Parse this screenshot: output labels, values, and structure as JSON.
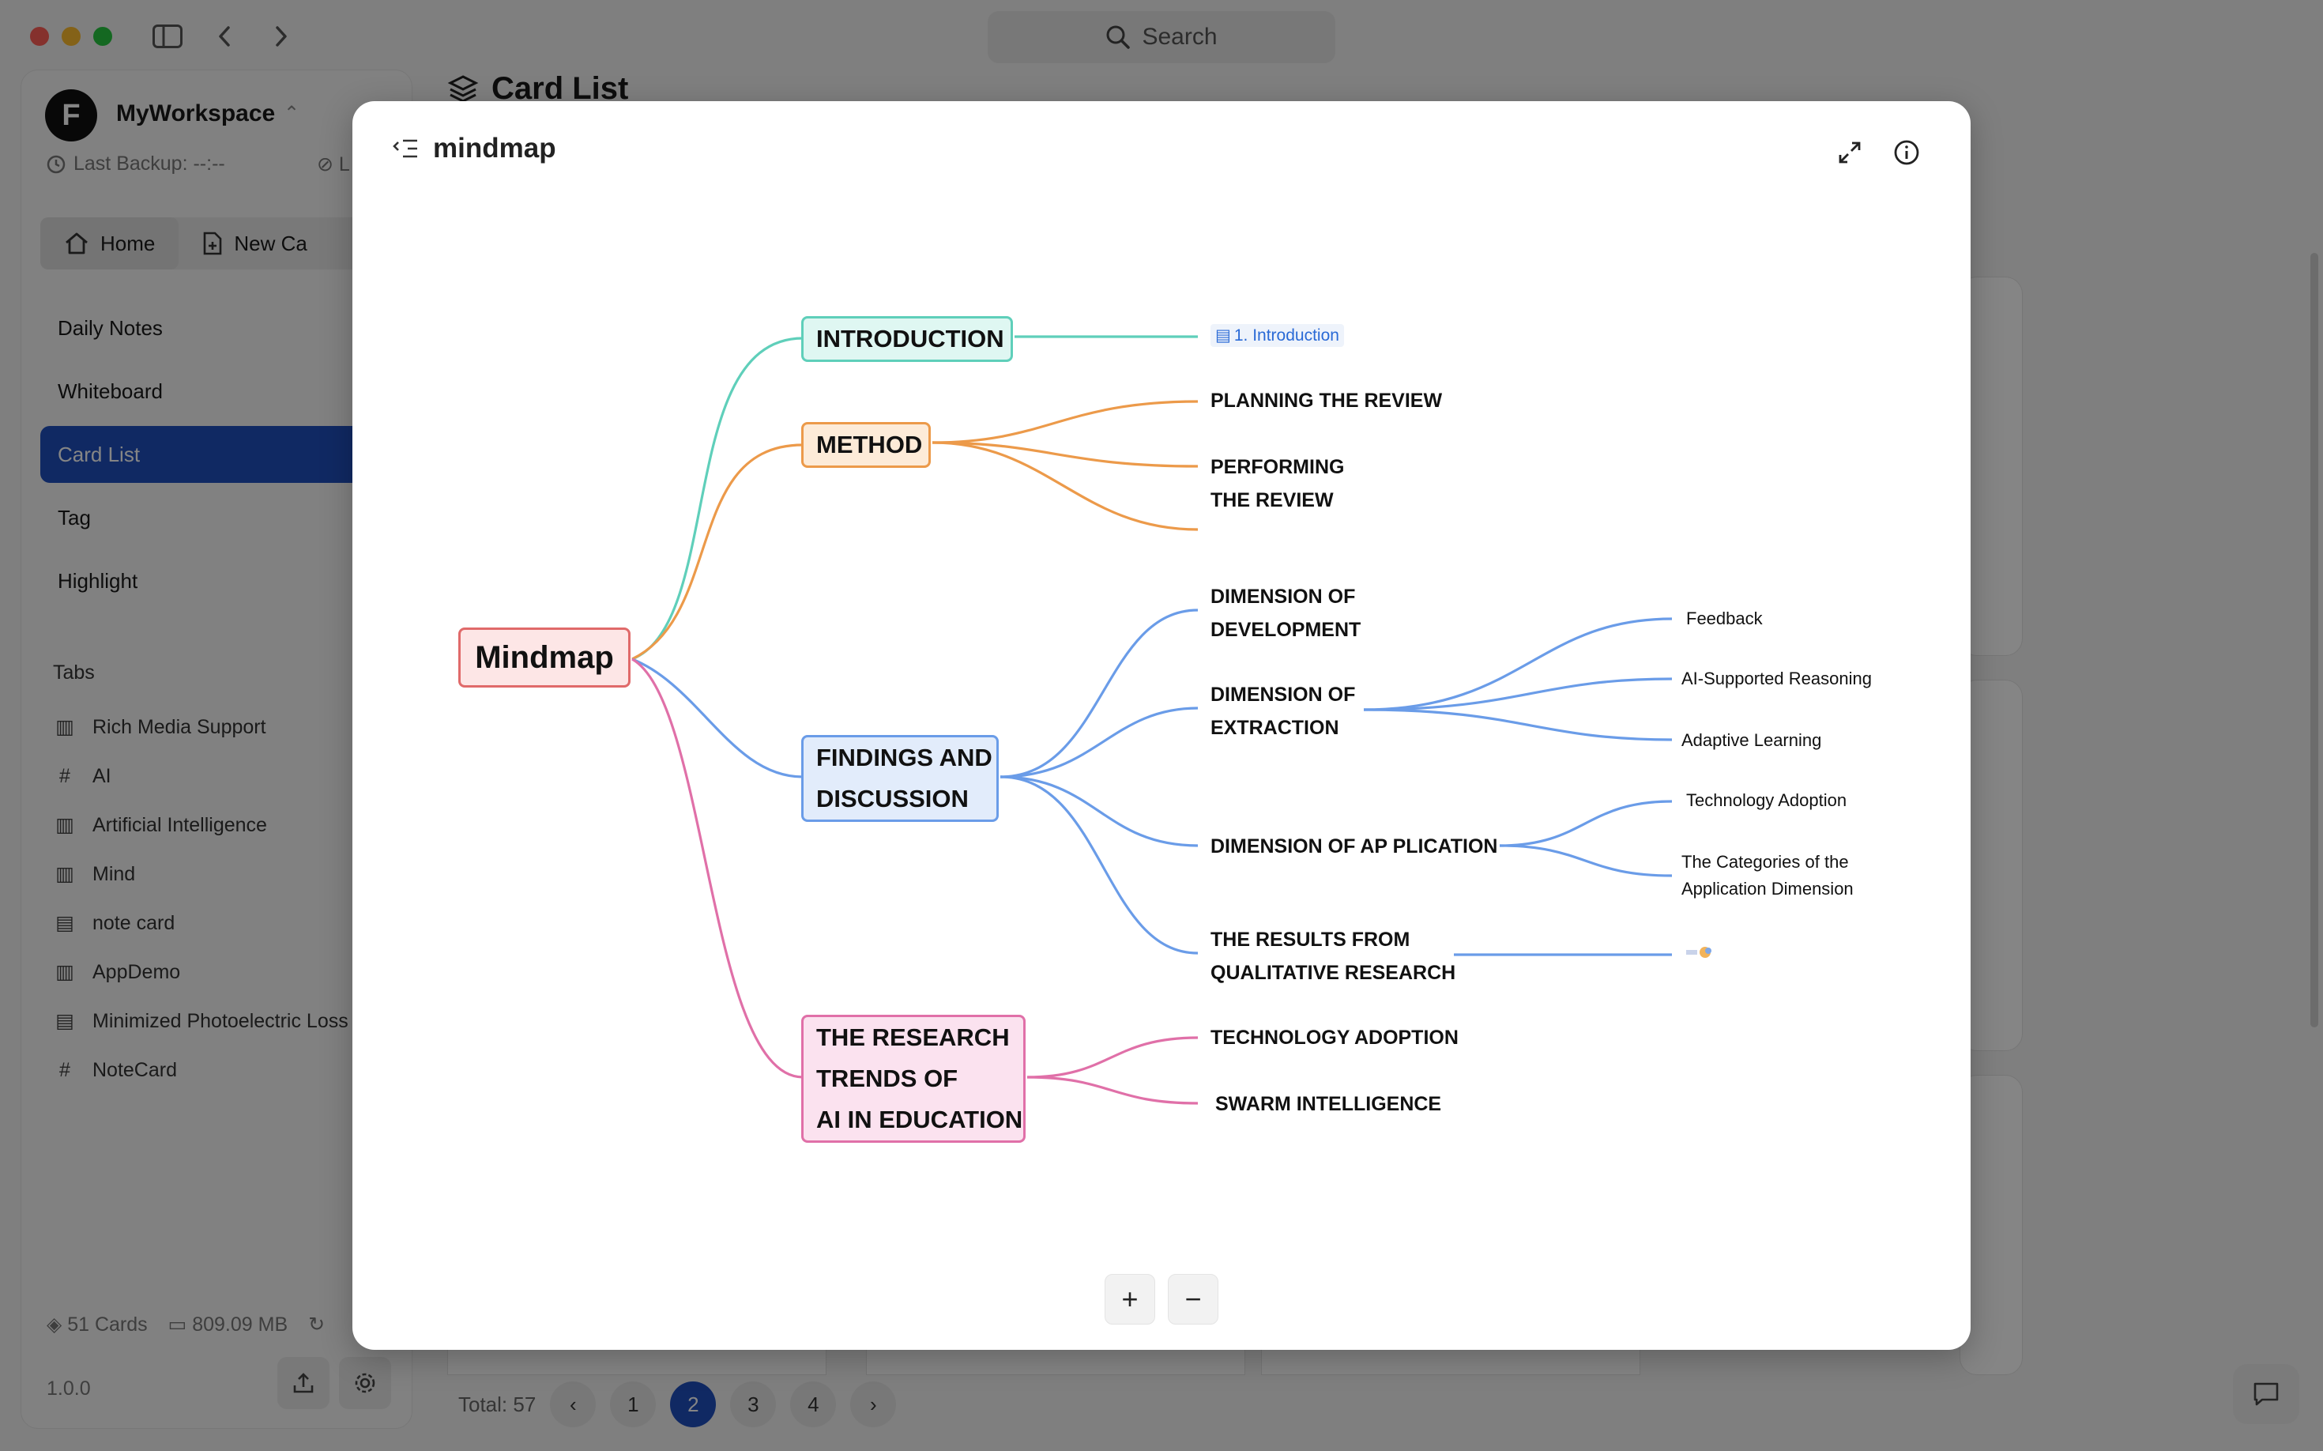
{
  "window": {
    "search_placeholder": "Search"
  },
  "workspace": {
    "logo_letter": "F",
    "name": "MyWorkspace",
    "last_backup": "Last Backup: --:--",
    "second_status": "L"
  },
  "nav_tabs": [
    {
      "label": "Home"
    },
    {
      "label": "New Ca"
    }
  ],
  "nav_items": [
    {
      "label": "Daily Notes"
    },
    {
      "label": "Whiteboard"
    },
    {
      "label": "Card List"
    },
    {
      "label": "Tag"
    },
    {
      "label": "Highlight"
    }
  ],
  "tabs_section": {
    "heading": "Tabs",
    "items": [
      {
        "label": "Rich Media Support",
        "icon": "map-icon"
      },
      {
        "label": "AI",
        "icon": "hash-icon"
      },
      {
        "label": "Artificial Intelligence",
        "icon": "map-icon"
      },
      {
        "label": "Mind",
        "icon": "map-icon"
      },
      {
        "label": "note card",
        "icon": "doc-icon"
      },
      {
        "label": "AppDemo",
        "icon": "map-icon"
      },
      {
        "label": "Minimized Photoelectric Loss",
        "icon": "doc-icon"
      },
      {
        "label": "NoteCard",
        "icon": "hash-icon"
      }
    ]
  },
  "footer": {
    "cards": "51 Cards",
    "storage": "809.09 MB",
    "version": "1.0.0"
  },
  "content": {
    "title": "Card List",
    "total": "Total: 57",
    "pages": [
      "1",
      "2",
      "3",
      "4"
    ],
    "active_page": "2"
  },
  "modal": {
    "title": "mindmap",
    "zoom_in": "+",
    "zoom_out": "−"
  },
  "mindmap": {
    "root": "Mindmap",
    "introduction": {
      "label": "INTRODUCTION",
      "link": "1. Introduction"
    },
    "method": {
      "label": "METHOD",
      "children": [
        "PLANNING THE REVIEW",
        "PERFORMING",
        "THE REVIEW"
      ]
    },
    "findings": {
      "label_line1": "FINDINGS AND",
      "label_line2": "DISCUSSION",
      "dim_dev_1": "DIMENSION OF",
      "dim_dev_2": "DEVELOPMENT",
      "dim_ext_1": "DIMENSION OF",
      "dim_ext_2": "EXTRACTION",
      "dim_ext_children": [
        "Feedback",
        "AI-Supported Reasoning",
        "Adaptive Learning"
      ],
      "dim_app": "DIMENSION OF AP PLICATION",
      "dim_app_children": [
        "Technology Adoption",
        "The Categories of the",
        "Application Dimension"
      ],
      "results_1": "THE RESULTS FROM",
      "results_2": "QUALITATIVE RESEARCH"
    },
    "trends": {
      "line1": "THE RESEARCH",
      "line2": "TRENDS OF",
      "line3": "AI IN EDUCATION",
      "children": [
        "TECHNOLOGY ADOPTION",
        "SWARM INTELLIGENCE"
      ]
    },
    "colors": {
      "intro": "#5fcfba",
      "method": "#ec9a4a",
      "findings": "#6a9ce8",
      "trends": "#e070a8",
      "root_border": "#e06a6a"
    }
  }
}
